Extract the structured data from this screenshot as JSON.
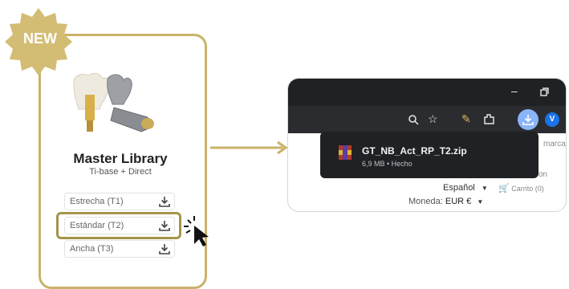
{
  "badge": {
    "text": "NEW"
  },
  "library": {
    "title": "Master Library",
    "subtitle": "Ti-base + Direct",
    "items": [
      {
        "label": "Estrecha (T1)"
      },
      {
        "label": "Estándar (T2)"
      },
      {
        "label": "Ancha (T3)"
      }
    ]
  },
  "browser": {
    "bookmarks_text": "marcad",
    "download": {
      "filename": "GT_NB_Act_RP_T2.zip",
      "meta": "6,9 MB • Hecho"
    },
    "page": {
      "truncated": "on",
      "language": "Español",
      "cart": "Carrito (0)",
      "currency_label": "Moneda:",
      "currency_value": "EUR €"
    },
    "profile_initial": "V"
  },
  "colors": {
    "gold": "#c9b26a",
    "gold_dark": "#a5944b",
    "chrome_dark": "#202124",
    "download_blue": "#8ab4f8"
  },
  "icons": [
    "download-icon",
    "search-icon",
    "star-icon",
    "extension-icon",
    "minimize-icon",
    "restore-icon",
    "cart-icon",
    "zip-file-icon",
    "cursor-icon",
    "arrow-icon"
  ]
}
